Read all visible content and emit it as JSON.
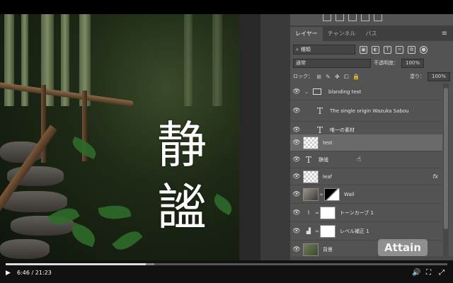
{
  "canvas": {
    "kanji_top": "静",
    "kanji_bottom": "謐"
  },
  "panel": {
    "tabs": [
      "レイヤー",
      "チャンネル",
      "パス"
    ],
    "active_tab": "レイヤー",
    "kind_filter": "種類",
    "blend_mode": "通常",
    "opacity_label": "不透明度：",
    "opacity_value": "100%",
    "lock_label": "ロック：",
    "fill_label": "塗り：",
    "fill_value": "100%"
  },
  "layers": [
    {
      "name": "blanding text",
      "type": "group"
    },
    {
      "name": "The single origin Wazuka Sabou",
      "type": "text"
    },
    {
      "name": "唯一の素材",
      "type": "text"
    },
    {
      "name": "test",
      "type": "pixel",
      "selected": true
    },
    {
      "name": "静謐",
      "type": "text"
    },
    {
      "name": "leaf",
      "type": "smart",
      "fx": "fx"
    },
    {
      "name": "Wall",
      "type": "masked"
    },
    {
      "name": "トーンカーブ 1",
      "type": "adjustment",
      "icon": "curves-icon"
    },
    {
      "name": "レベル補正 1",
      "type": "adjustment",
      "icon": "levels-icon"
    },
    {
      "name": "背景",
      "type": "background"
    }
  ],
  "watermark": {
    "text": "Attain"
  },
  "player": {
    "current_time": "6:46",
    "total_time": "21:23",
    "progress_fraction": 0.317
  },
  "colors": {
    "panel_bg": "#535353",
    "selected_layer": "#6a6a6a",
    "player_bg": "#111111"
  }
}
